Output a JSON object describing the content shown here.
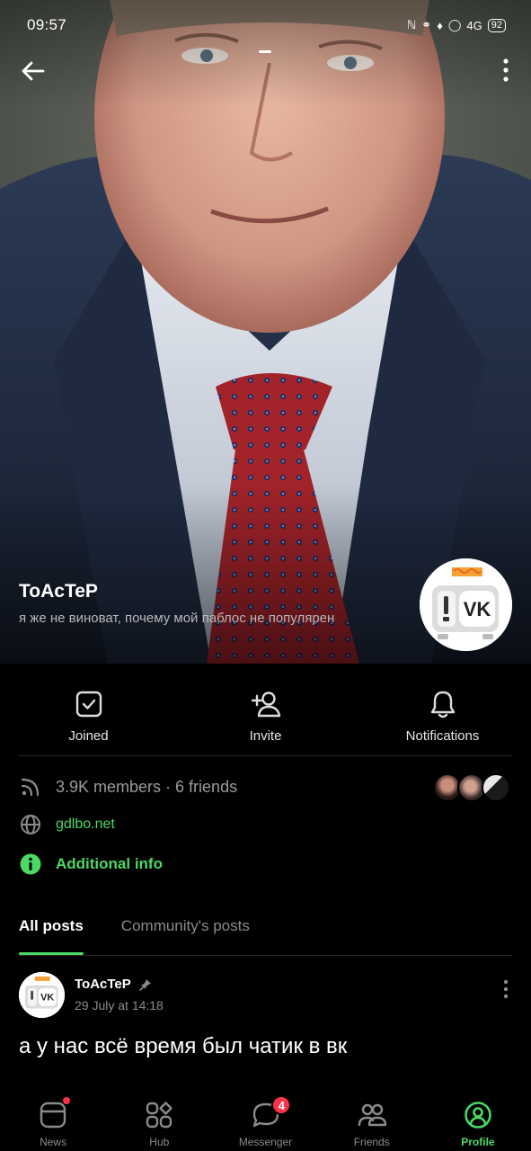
{
  "status_bar": {
    "time": "09:57",
    "signal": "4G",
    "battery": "92"
  },
  "group": {
    "name": "ToAcTeP",
    "status": "я же не виноват, почему мой паблос не популярен"
  },
  "actions": [
    {
      "label": "Joined",
      "icon": "check-square-icon"
    },
    {
      "label": "Invite",
      "icon": "add-user-icon"
    },
    {
      "label": "Notifications",
      "icon": "bell-icon"
    }
  ],
  "info": {
    "members": "3.9K members · 6 friends",
    "link": "gdlbo.net",
    "additional": "Additional info"
  },
  "tabs": [
    {
      "label": "All posts",
      "active": true
    },
    {
      "label": "Community's posts",
      "active": false
    }
  ],
  "post": {
    "author": "ToAcTeP",
    "date": "29 July at 14:18",
    "text": "а у нас всё время был чатик в вк"
  },
  "nav": [
    {
      "label": "News",
      "icon": "news-icon",
      "dot": true
    },
    {
      "label": "Hub",
      "icon": "hub-icon"
    },
    {
      "label": "Messenger",
      "icon": "messenger-icon",
      "badge": "4"
    },
    {
      "label": "Friends",
      "icon": "friends-icon"
    },
    {
      "label": "Profile",
      "icon": "profile-icon",
      "active": true
    }
  ],
  "colors": {
    "accent": "#4bd865",
    "badge": "#ff3347",
    "background": "#000000"
  }
}
